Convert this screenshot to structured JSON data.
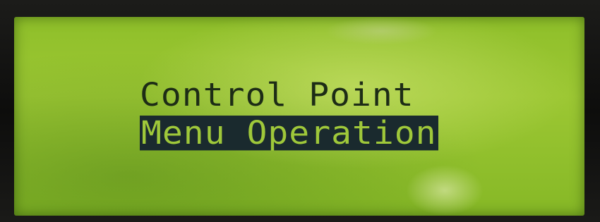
{
  "lcd": {
    "line1": "Control Point",
    "line2": "Menu Operation",
    "selected_line": 2
  },
  "colors": {
    "backlight": "#9cc733",
    "pixel_on": "#1d2c16",
    "highlight_bg": "#1a2a2e",
    "bezel": "#141414"
  }
}
